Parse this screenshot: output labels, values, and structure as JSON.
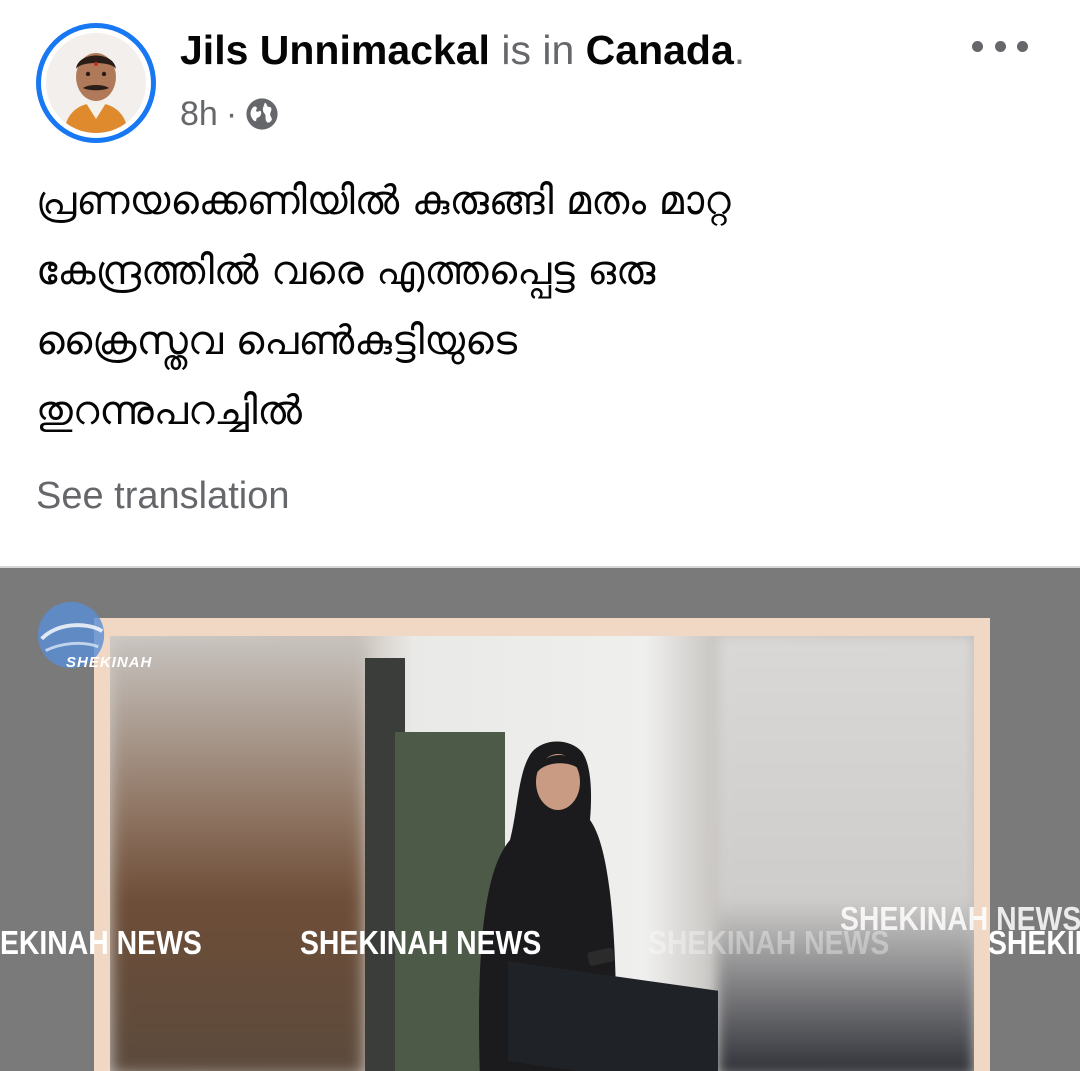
{
  "post": {
    "author": "Jils Unnimackal",
    "location_prefix": "is in",
    "location": "Canada",
    "location_suffix": ".",
    "time": "8h",
    "separator": "·",
    "privacy_icon": "globe-icon",
    "more_icon": "more-options-icon",
    "text_lines": [
      "പ്രണയക്കെണിയിൽ കുരുങ്ങി മതം മാറ്റ",
      "കേന്ദ്രത്തിൽ വരെ എത്തപ്പെട്ട ഒരു",
      "ക്രൈസ്തവ പെൺകുട്ടിയുടെ",
      "തുറന്നുപറച്ചിൽ"
    ],
    "see_translation": "See translation"
  },
  "media": {
    "logo_text": "SHEKINAH",
    "watermarks": [
      "EKINAH NEWS",
      "SHEKINAH NEWS",
      "SHEKINAH NEWS",
      "SHEKIN",
      "SHEKINAH NEWS"
    ]
  },
  "colors": {
    "accent": "#1877f2",
    "text_primary": "#050505",
    "text_secondary": "#65676b"
  }
}
